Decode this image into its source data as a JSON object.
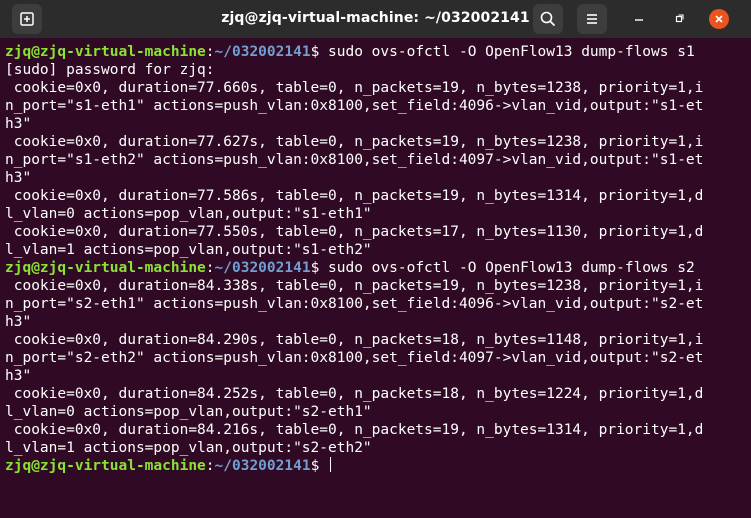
{
  "window": {
    "title": "zjq@zjq-virtual-machine: ~/032002141"
  },
  "icons": {
    "new_tab": "new-tab-icon",
    "search": "search-icon",
    "menu": "hamburger-menu-icon",
    "minimize": "minimize-icon",
    "maximize": "maximize-icon",
    "close": "close-icon"
  },
  "colors": {
    "background": "#300a24",
    "prompt_user": "#8ae234",
    "prompt_path": "#729fcf",
    "text": "#ffffff",
    "close_button": "#e95420",
    "titlebar": "#2c2c2c"
  },
  "terminal": {
    "prompt": {
      "user_host": "zjq@zjq-virtual-machine",
      "separator": ":",
      "path": "~/032002141",
      "dollar": "$ "
    },
    "commands": {
      "cmd1": "sudo ovs-ofctl -O OpenFlow13 dump-flows s1",
      "cmd2": "sudo ovs-ofctl -O OpenFlow13 dump-flows s2"
    },
    "output": [
      "[sudo] password for zjq:",
      " cookie=0x0, duration=77.660s, table=0, n_packets=19, n_bytes=1238, priority=1,i",
      "n_port=\"s1-eth1\" actions=push_vlan:0x8100,set_field:4096->vlan_vid,output:\"s1-et",
      "h3\"",
      " cookie=0x0, duration=77.627s, table=0, n_packets=19, n_bytes=1238, priority=1,i",
      "n_port=\"s1-eth2\" actions=push_vlan:0x8100,set_field:4097->vlan_vid,output:\"s1-et",
      "h3\"",
      " cookie=0x0, duration=77.586s, table=0, n_packets=19, n_bytes=1314, priority=1,d",
      "l_vlan=0 actions=pop_vlan,output:\"s1-eth1\"",
      " cookie=0x0, duration=77.550s, table=0, n_packets=17, n_bytes=1130, priority=1,d",
      "l_vlan=1 actions=pop_vlan,output:\"s1-eth2\"",
      " cookie=0x0, duration=84.338s, table=0, n_packets=19, n_bytes=1238, priority=1,i",
      "n_port=\"s2-eth1\" actions=push_vlan:0x8100,set_field:4096->vlan_vid,output:\"s2-et",
      "h3\"",
      " cookie=0x0, duration=84.290s, table=0, n_packets=18, n_bytes=1148, priority=1,i",
      "n_port=\"s2-eth2\" actions=push_vlan:0x8100,set_field:4097->vlan_vid,output:\"s2-et",
      "h3\"",
      " cookie=0x0, duration=84.252s, table=0, n_packets=18, n_bytes=1224, priority=1,d",
      "l_vlan=0 actions=pop_vlan,output:\"s2-eth1\"",
      " cookie=0x0, duration=84.216s, table=0, n_packets=19, n_bytes=1314, priority=1,d",
      "l_vlan=1 actions=pop_vlan,output:\"s2-eth2\""
    ]
  }
}
